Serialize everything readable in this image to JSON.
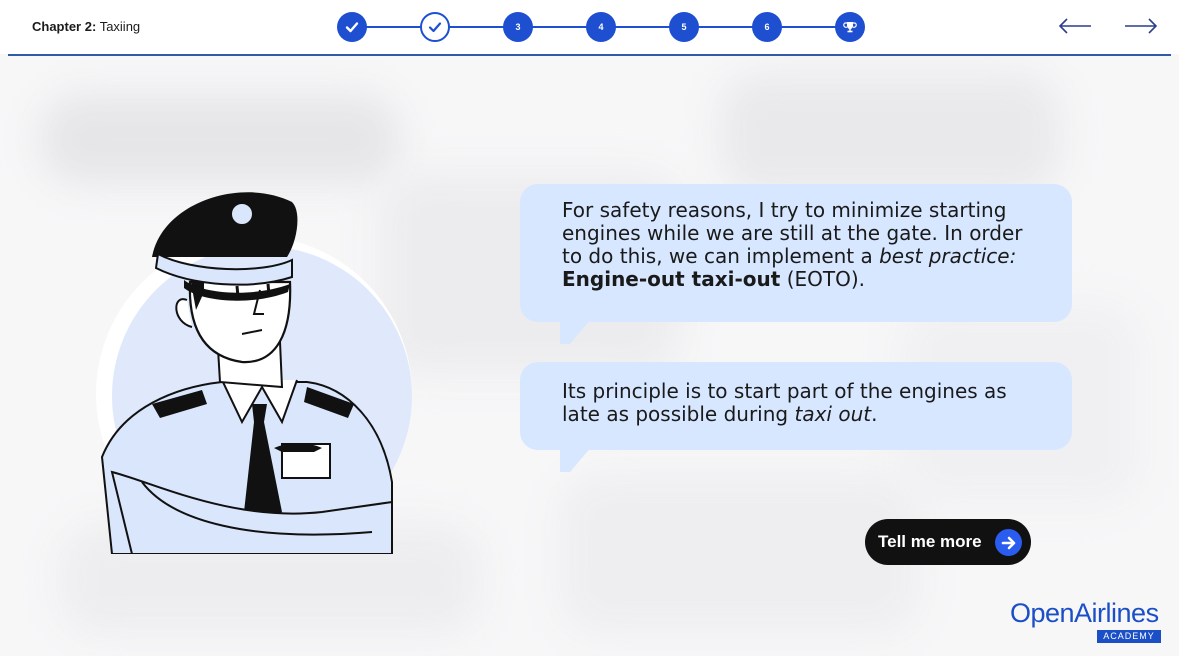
{
  "header": {
    "chapter_label": "Chapter 2:",
    "chapter_title": "Taxiing",
    "steps": [
      {
        "label": "",
        "state": "done",
        "icon": "check-icon"
      },
      {
        "label": "",
        "state": "current",
        "icon": "check-icon"
      },
      {
        "label": "3",
        "state": "todo"
      },
      {
        "label": "4",
        "state": "todo"
      },
      {
        "label": "5",
        "state": "todo"
      },
      {
        "label": "6",
        "state": "todo"
      },
      {
        "label": "",
        "state": "todo",
        "icon": "trophy-icon"
      }
    ],
    "nav": {
      "prev_icon": "arrow-left-icon",
      "next_icon": "arrow-right-icon"
    }
  },
  "dialog": {
    "bubble1": {
      "part1": "For safety reasons, I try to minimize starting engines while we are still at the gate. In order to do this, we can implement a ",
      "emph": "best practice:",
      "strong": "Engine-out taxi-out",
      "part2": " (EOTO)."
    },
    "bubble2": {
      "part1": "Its principle is to start part of the engines as late as possible during ",
      "emph": "taxi out",
      "part2": "."
    }
  },
  "cta": {
    "label": "Tell me more",
    "icon": "arrow-right-circle-icon"
  },
  "logo": {
    "name": "OpenAirlines",
    "badge": "ACADEMY"
  },
  "colors": {
    "accent": "#1d4fd0",
    "bubble": "#d7e7ff",
    "line": "#2f5aa8"
  }
}
